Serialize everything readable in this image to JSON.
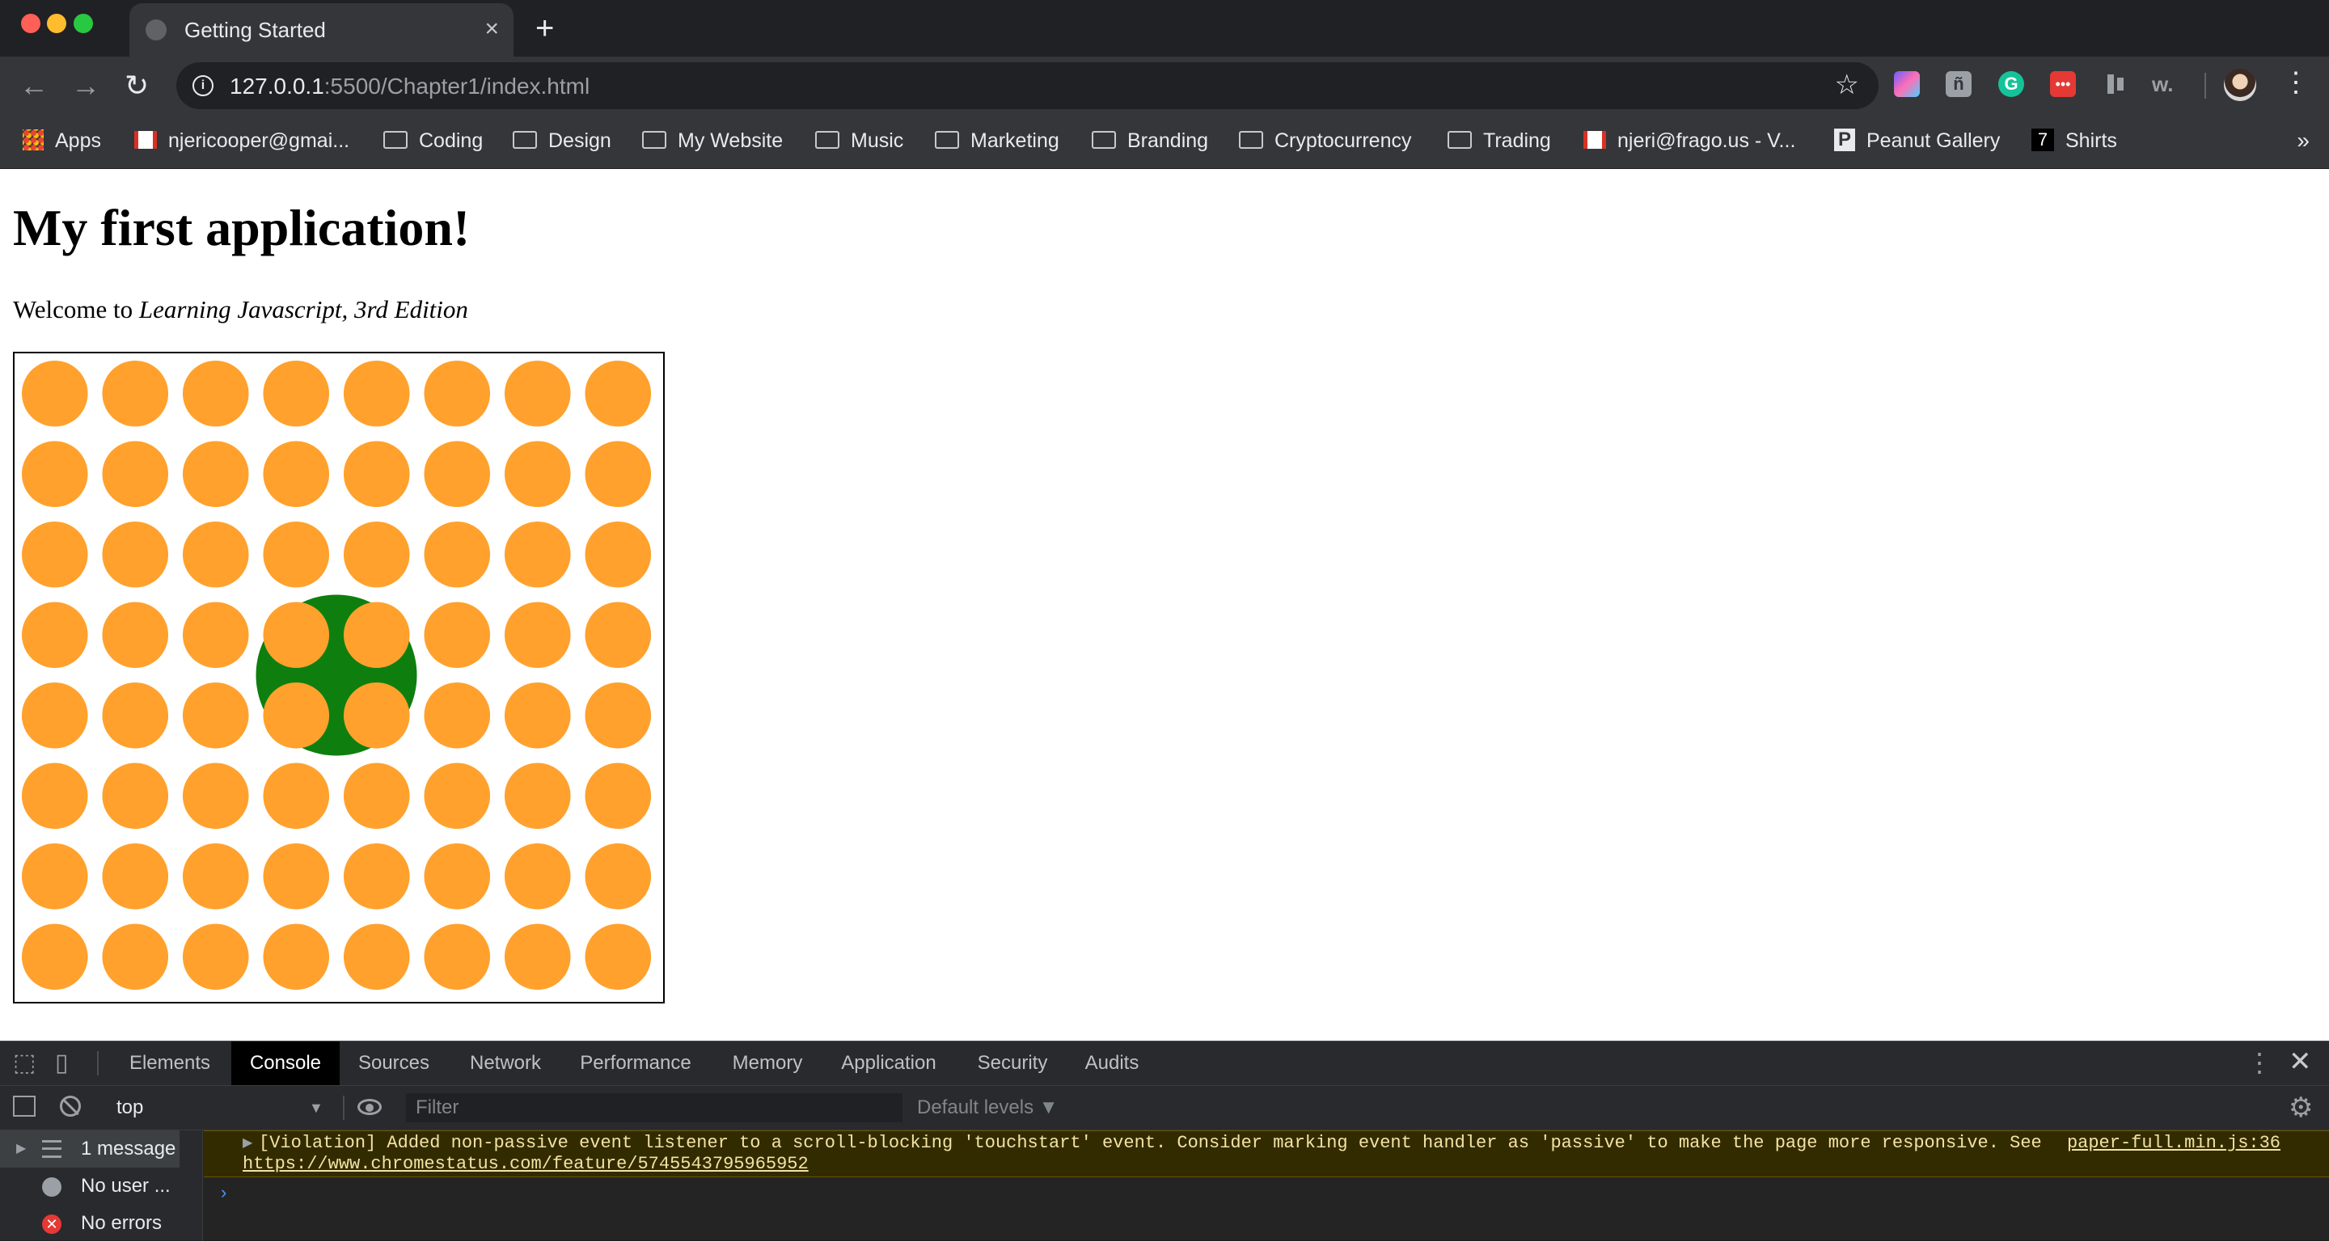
{
  "browser": {
    "tab_title": "Getting Started",
    "tab_close": "×",
    "new_tab": "+",
    "url_host": "127.0.0.1",
    "url_rest": ":5500/Chapter1/index.html",
    "icons": [
      "back-arrow-icon",
      "forward-arrow-icon",
      "reload-icon",
      "info-icon",
      "star-icon",
      "kebab-menu-icon"
    ],
    "bookmarks": [
      {
        "label": "Apps",
        "icon": "apps-grid-icon"
      },
      {
        "label": "njericooper@gmai...",
        "icon": "gmail-icon"
      },
      {
        "label": "Coding",
        "icon": "folder-icon"
      },
      {
        "label": "Design",
        "icon": "folder-icon"
      },
      {
        "label": "My Website",
        "icon": "folder-icon"
      },
      {
        "label": "Music",
        "icon": "folder-icon"
      },
      {
        "label": "Marketing",
        "icon": "folder-icon"
      },
      {
        "label": "Branding",
        "icon": "folder-icon"
      },
      {
        "label": "Cryptocurrency",
        "icon": "folder-icon"
      },
      {
        "label": "Trading",
        "icon": "folder-icon"
      },
      {
        "label": "njeri@frago.us - V...",
        "icon": "gmail-icon"
      },
      {
        "label": "Peanut Gallery",
        "icon": "peanut-gallery-icon"
      },
      {
        "label": "Shirts",
        "icon": "shirts-icon"
      }
    ],
    "bookmarks_more": "»"
  },
  "page": {
    "heading": "My first application!",
    "welcome_prefix": "Welcome to ",
    "welcome_book": "Learning Javascript, 3rd Edition",
    "canvas": {
      "grid_rows": 8,
      "grid_cols": 8,
      "dot_color": "#ffa12c",
      "center_circle_color": "#0e7f0e",
      "center_circle_position": "centered between rows 4–5, cols 4–5 (behind dots)"
    }
  },
  "devtools": {
    "tabs": [
      "Elements",
      "Console",
      "Sources",
      "Network",
      "Performance",
      "Memory",
      "Application",
      "Security",
      "Audits"
    ],
    "active_tab": "Console",
    "context": "top",
    "filter_placeholder": "Filter",
    "levels": "Default levels ▼",
    "sidebar": [
      {
        "label": "1 message",
        "icon": "list-icon"
      },
      {
        "label": "No user ...",
        "icon": "user-icon"
      },
      {
        "label": "No errors",
        "icon": "error-icon"
      }
    ],
    "messages": [
      {
        "text": "[Violation] Added non-passive event listener to a scroll-blocking 'touchstart' event. Consider marking event handler as 'passive' to make the page more responsive. See",
        "link": "https://www.chromestatus.com/feature/5745543795965952",
        "source": "paper-full.min.js:36"
      }
    ],
    "prompt": "›"
  }
}
